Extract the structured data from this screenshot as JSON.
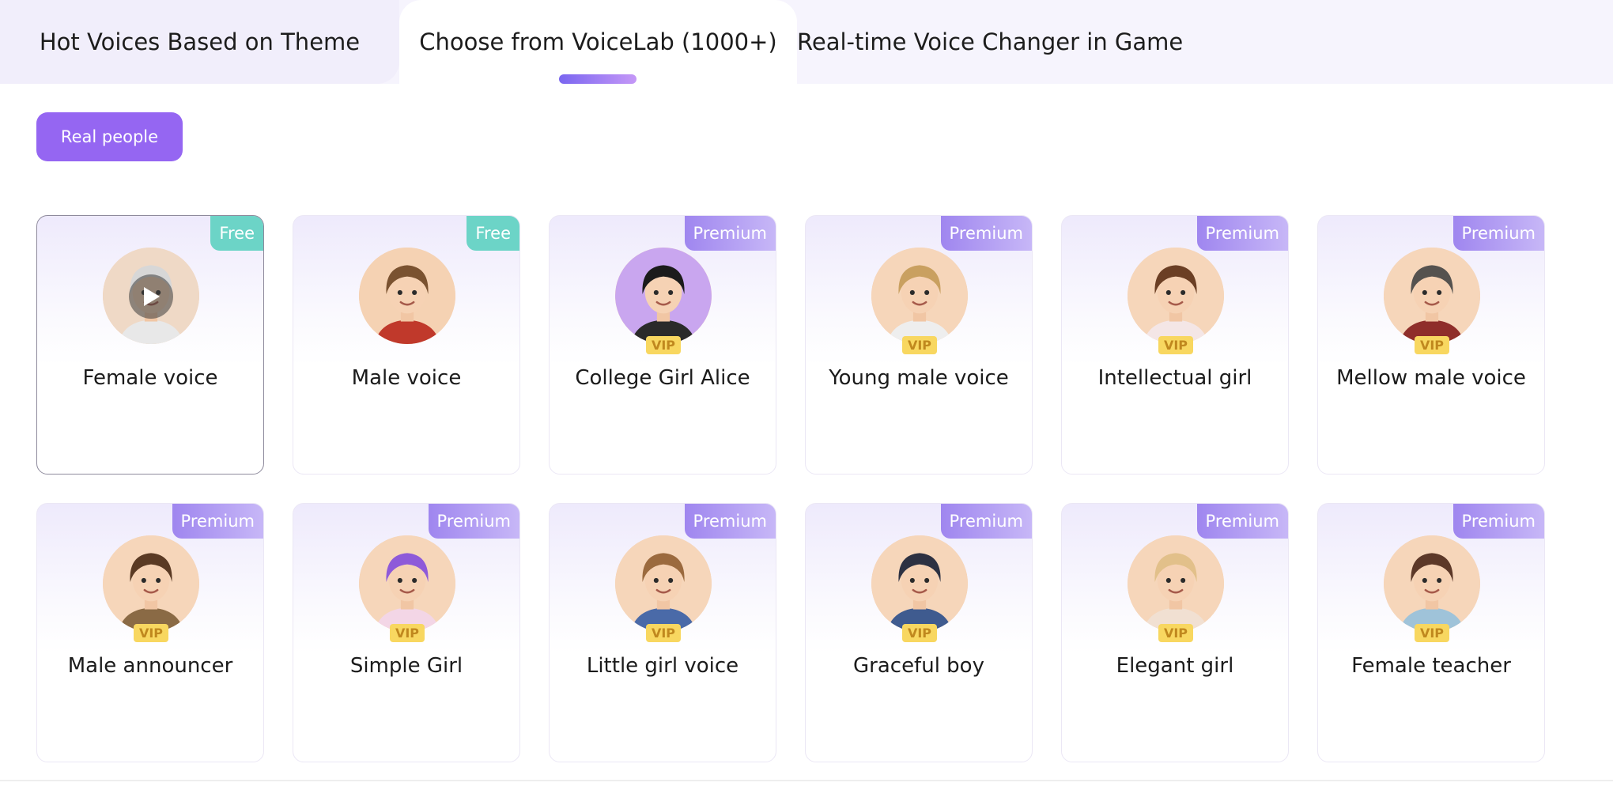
{
  "tabs": [
    {
      "label": "Hot Voices Based on Theme"
    },
    {
      "label": "Choose from VoiceLab (1000+)"
    },
    {
      "label": "Real-time Voice Changer in Game"
    }
  ],
  "active_tab": 1,
  "filter": {
    "label": "Real people"
  },
  "vip_label": "VIP",
  "colors": {
    "accent": "#9566f2",
    "free_badge": "#6cd4c7",
    "premium_badge": "#a78bf0",
    "vip": "#f8d760"
  },
  "voices": [
    {
      "name": "Female voice",
      "badge": "Free",
      "vip": false,
      "selected": true,
      "icon": "play-icon",
      "hair": "#d7d7d7",
      "shirt": "#e8e8e8",
      "bg": "#efd9c6"
    },
    {
      "name": "Male voice",
      "badge": "Free",
      "vip": false,
      "selected": false,
      "icon": "cowboy-avatar-icon",
      "hair": "#7a5230",
      "shirt": "#c0392b",
      "bg": "#f5d2b3"
    },
    {
      "name": "College Girl Alice",
      "badge": "Premium",
      "vip": true,
      "selected": false,
      "icon": "girl-avatar-icon",
      "hair": "#1b1b1b",
      "shirt": "#2a2a2a",
      "bg": "#c9a6ef"
    },
    {
      "name": "Young male voice",
      "badge": "Premium",
      "vip": true,
      "selected": false,
      "icon": "young-man-avatar-icon",
      "hair": "#c9a060",
      "shirt": "#eeeeee",
      "bg": "#f6d6ba"
    },
    {
      "name": "Intellectual girl",
      "badge": "Premium",
      "vip": true,
      "selected": false,
      "icon": "woman-avatar-icon",
      "hair": "#6b3f24",
      "shirt": "#f4e6e6",
      "bg": "#f6d6ba"
    },
    {
      "name": "Mellow male voice",
      "badge": "Premium",
      "vip": true,
      "selected": false,
      "icon": "bearded-man-avatar-icon",
      "hair": "#55524f",
      "shirt": "#8f2e2a",
      "bg": "#f6d6ba"
    },
    {
      "name": "Male announcer",
      "badge": "Premium",
      "vip": true,
      "selected": false,
      "icon": "announcer-avatar-icon",
      "hair": "#5a3a24",
      "shirt": "#8a6a45",
      "bg": "#f6d6ba"
    },
    {
      "name": "Simple Girl",
      "badge": "Premium",
      "vip": true,
      "selected": false,
      "icon": "purple-hair-girl-avatar-icon",
      "hair": "#8e5ad9",
      "shirt": "#f3d6e6",
      "bg": "#f6d6ba"
    },
    {
      "name": "Little girl voice",
      "badge": "Premium",
      "vip": true,
      "selected": false,
      "icon": "little-girl-avatar-icon",
      "hair": "#9b6a3e",
      "shirt": "#4a6aa8",
      "bg": "#f6d6ba"
    },
    {
      "name": "Graceful boy",
      "badge": "Premium",
      "vip": true,
      "selected": false,
      "icon": "suited-boy-avatar-icon",
      "hair": "#2d3142",
      "shirt": "#3f5b8f",
      "bg": "#f6d6ba"
    },
    {
      "name": "Elegant girl",
      "badge": "Premium",
      "vip": true,
      "selected": false,
      "icon": "blonde-girl-avatar-icon",
      "hair": "#e2c08a",
      "shirt": "#f1e0d2",
      "bg": "#f6d6ba"
    },
    {
      "name": "Female teacher",
      "badge": "Premium",
      "vip": true,
      "selected": false,
      "icon": "teacher-avatar-icon",
      "hair": "#5c3828",
      "shirt": "#9fc3d9",
      "bg": "#f6d6ba"
    }
  ]
}
